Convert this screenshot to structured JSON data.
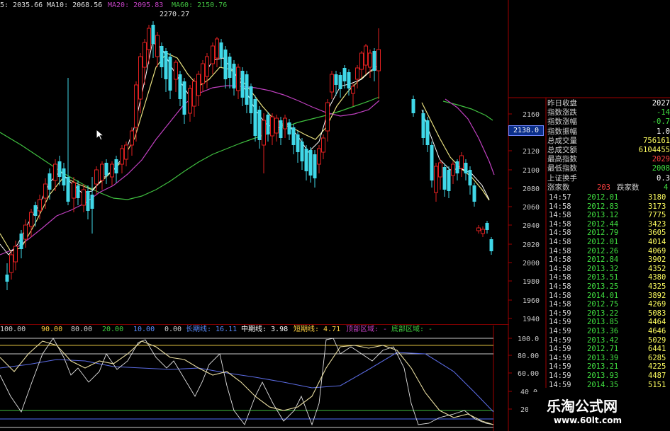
{
  "ma_bar": [
    {
      "text": "5: 2035.66",
      "color": "#dcdcdc"
    },
    {
      "text": "MA10: 2068.56",
      "color": "#dcdcdc"
    },
    {
      "text": "MA20: 2095.83",
      "color": "#c040c0"
    },
    {
      "text": "MA60: 2150.76",
      "color": "#40c040"
    }
  ],
  "high_label": "2270.27",
  "price_axis": {
    "ticks": [
      "2160",
      "2140",
      "2120",
      "2100",
      "2080",
      "2060",
      "2040",
      "2020",
      "2000",
      "1980",
      "1960",
      "1940"
    ],
    "marker": "2138.0"
  },
  "osc_axis": {
    "ticks": [
      "100.0",
      "80.00",
      "60.00",
      "40.0",
      "20.0"
    ]
  },
  "osc_legend": [
    {
      "text": "100.00",
      "color": "#d0d0d0"
    },
    {
      "text": "90.00",
      "color": "#ffd040"
    },
    {
      "text": "80.00",
      "color": "#d0d0d0"
    },
    {
      "text": "20.00",
      "color": "#40d040"
    },
    {
      "text": "10.00",
      "color": "#5a8cff"
    },
    {
      "text": "0.00",
      "color": "#d0d0d0"
    },
    {
      "text": "长期线: 16.11",
      "color": "#5a8cff"
    },
    {
      "text": "中期线: 3.98",
      "color": "#ffffff"
    },
    {
      "text": "短期线: 4.71",
      "color": "#ffd040"
    },
    {
      "text": "顶部区域: -",
      "color": "#c040c0"
    },
    {
      "text": "底部区域: -",
      "color": "#40d040"
    }
  ],
  "index_info": [
    {
      "label": "昨日收盘",
      "value": "2027",
      "color": "#ffffff"
    },
    {
      "label": "指数涨跌",
      "value": "-14",
      "color": "#40e040"
    },
    {
      "label": "指数涨幅",
      "value": "-0.7",
      "color": "#40e040"
    },
    {
      "label": "指数振幅",
      "value": "1.0",
      "color": "#ffffff"
    },
    {
      "label": "总成交量",
      "value": "756161",
      "color": "#ffff60"
    },
    {
      "label": "总成交额",
      "value": "6104455",
      "color": "#ffff60"
    },
    {
      "label": "最高指数",
      "value": "2029",
      "color": "#ff4040"
    },
    {
      "label": "最低指数",
      "value": "2008",
      "color": "#40e040"
    },
    {
      "label": "上证换手",
      "value": "0.3",
      "color": "#ffffff"
    }
  ],
  "advance_decline": {
    "up_label": "涨家数",
    "up_value": "203",
    "down_label": "跌家数",
    "down_value": "4"
  },
  "ticks": [
    {
      "time": "14:57",
      "price": "2012.01",
      "vol": "3180"
    },
    {
      "time": "14:58",
      "price": "2012.83",
      "vol": "3173"
    },
    {
      "time": "14:58",
      "price": "2013.12",
      "vol": "7775"
    },
    {
      "time": "14:58",
      "price": "2012.44",
      "vol": "3423"
    },
    {
      "time": "14:58",
      "price": "2012.79",
      "vol": "3605"
    },
    {
      "time": "14:58",
      "price": "2012.01",
      "vol": "4014"
    },
    {
      "time": "14:58",
      "price": "2012.26",
      "vol": "4069"
    },
    {
      "time": "14:58",
      "price": "2012.84",
      "vol": "3902"
    },
    {
      "time": "14:58",
      "price": "2013.32",
      "vol": "4352"
    },
    {
      "time": "14:58",
      "price": "2013.51",
      "vol": "4380"
    },
    {
      "time": "14:58",
      "price": "2013.25",
      "vol": "4325"
    },
    {
      "time": "14:58",
      "price": "2014.01",
      "vol": "3892"
    },
    {
      "time": "14:58",
      "price": "2012.75",
      "vol": "4269"
    },
    {
      "time": "14:59",
      "price": "2013.22",
      "vol": "5083"
    },
    {
      "time": "14:59",
      "price": "2013.85",
      "vol": "4464"
    },
    {
      "time": "14:59",
      "price": "2013.36",
      "vol": "4646"
    },
    {
      "time": "14:59",
      "price": "2013.42",
      "vol": "5029"
    },
    {
      "time": "14:59",
      "price": "2012.71",
      "vol": "6441"
    },
    {
      "time": "14:59",
      "price": "2013.39",
      "vol": "6285"
    },
    {
      "time": "14:59",
      "price": "2013.21",
      "vol": "4225"
    },
    {
      "time": "14:59",
      "price": "2013.93",
      "vol": "4487"
    },
    {
      "time": "14:59",
      "price": "2014.35",
      "vol": "5151"
    }
  ],
  "watermark": {
    "name": "乐淘公式网",
    "url": "www.60lt.com"
  },
  "colors": {
    "background": "#000000",
    "up_candle": "#e02020",
    "down_candle": "#40d8e8",
    "ma5": "#ffffff",
    "ma10": "#e8e080",
    "ma20": "#c040c0",
    "ma60": "#40c040",
    "axis": "#a00000"
  }
}
